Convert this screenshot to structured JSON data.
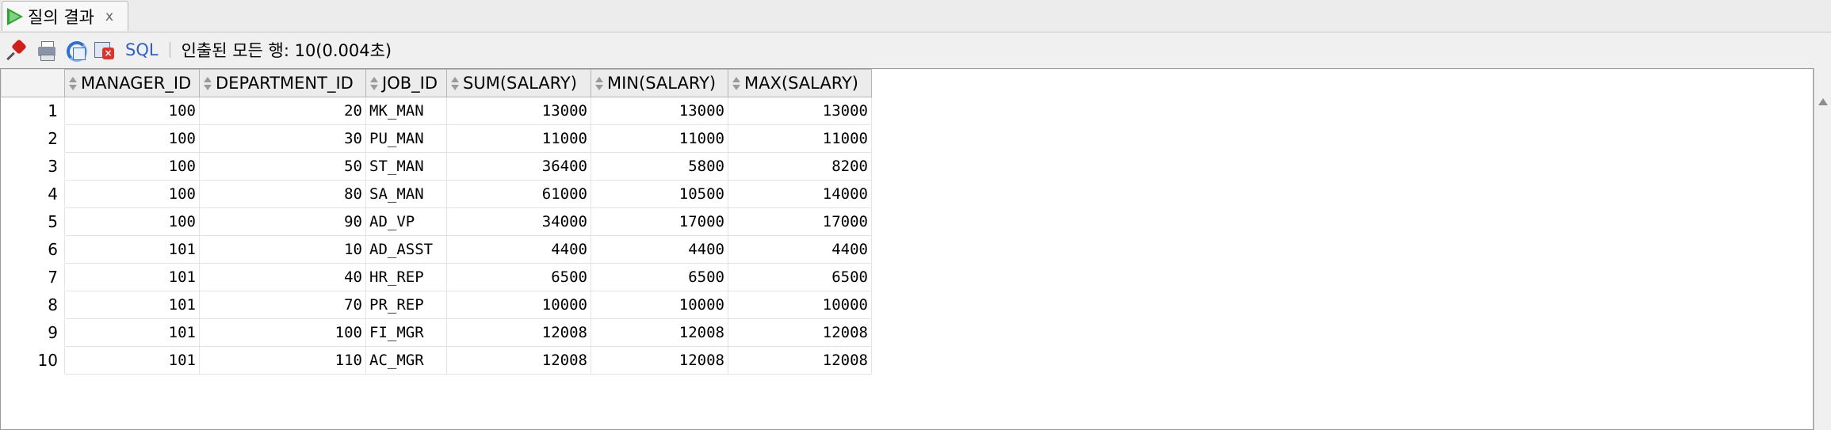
{
  "tab": {
    "label": "질의 결과",
    "close": "x"
  },
  "toolbar": {
    "sql_label": "SQL",
    "status": "인출된 모든 행: 10(0.004초)"
  },
  "table": {
    "columns": [
      "MANAGER_ID",
      "DEPARTMENT_ID",
      "JOB_ID",
      "SUM(SALARY)",
      "MIN(SALARY)",
      "MAX(SALARY)"
    ],
    "rows": [
      {
        "n": "1",
        "manager_id": "100",
        "department_id": "20",
        "job_id": "MK_MAN",
        "sum": "13000",
        "min": "13000",
        "max": "13000"
      },
      {
        "n": "2",
        "manager_id": "100",
        "department_id": "30",
        "job_id": "PU_MAN",
        "sum": "11000",
        "min": "11000",
        "max": "11000"
      },
      {
        "n": "3",
        "manager_id": "100",
        "department_id": "50",
        "job_id": "ST_MAN",
        "sum": "36400",
        "min": "5800",
        "max": "8200"
      },
      {
        "n": "4",
        "manager_id": "100",
        "department_id": "80",
        "job_id": "SA_MAN",
        "sum": "61000",
        "min": "10500",
        "max": "14000"
      },
      {
        "n": "5",
        "manager_id": "100",
        "department_id": "90",
        "job_id": "AD_VP",
        "sum": "34000",
        "min": "17000",
        "max": "17000"
      },
      {
        "n": "6",
        "manager_id": "101",
        "department_id": "10",
        "job_id": "AD_ASST",
        "sum": "4400",
        "min": "4400",
        "max": "4400"
      },
      {
        "n": "7",
        "manager_id": "101",
        "department_id": "40",
        "job_id": "HR_REP",
        "sum": "6500",
        "min": "6500",
        "max": "6500"
      },
      {
        "n": "8",
        "manager_id": "101",
        "department_id": "70",
        "job_id": "PR_REP",
        "sum": "10000",
        "min": "10000",
        "max": "10000"
      },
      {
        "n": "9",
        "manager_id": "101",
        "department_id": "100",
        "job_id": "FI_MGR",
        "sum": "12008",
        "min": "12008",
        "max": "12008"
      },
      {
        "n": "10",
        "manager_id": "101",
        "department_id": "110",
        "job_id": "AC_MGR",
        "sum": "12008",
        "min": "12008",
        "max": "12008"
      }
    ]
  },
  "icons": [
    "run-icon",
    "pin-icon",
    "print-icon",
    "refresh-icon",
    "cancel-icon",
    "sort-icon",
    "scroll-up-icon"
  ],
  "colors": {
    "run_green": "#2ea52e",
    "sql_link": "#2f5fc9",
    "cancel_red": "#e0322b"
  }
}
